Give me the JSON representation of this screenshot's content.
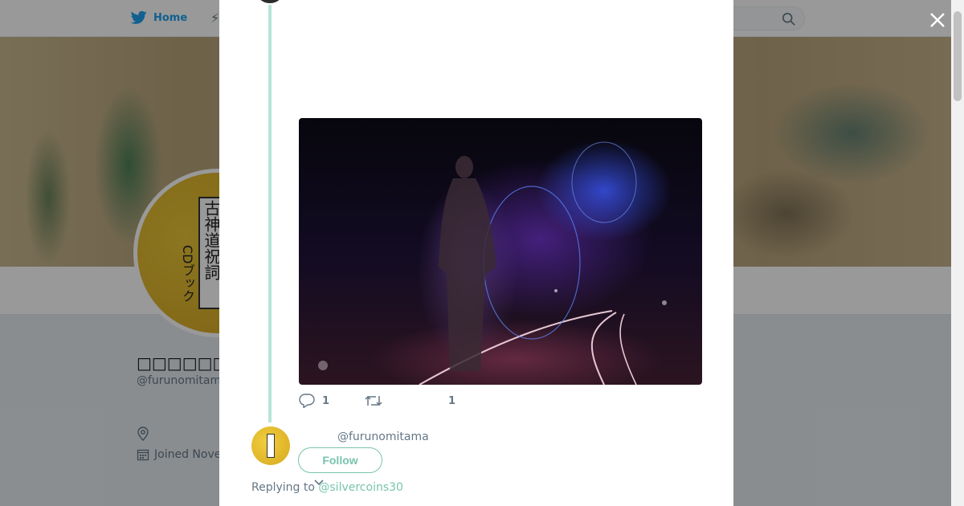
{
  "topbar": {
    "home_label": "Home",
    "home_icon": "twitter-bird-icon",
    "moments_icon": "lightning-icon",
    "search_icon": "search-icon"
  },
  "profile": {
    "name": "□□□□□□□□□□□",
    "handle": "@furunomitam",
    "joined": "Joined Nove",
    "avatar_text": "古神道祝詞",
    "avatar_sub": "CDブック"
  },
  "modal": {
    "close_icon": "close-icon",
    "tweet_image_desc_colors": {
      "accent_blue": "#3d5cff",
      "accent_purple": "#6e32c8"
    },
    "actions": {
      "reply_count": "1",
      "retweet_count": "",
      "like_count": "1"
    },
    "reply": {
      "handle": "@furunomitama",
      "follow_label": "Follow",
      "replying_prefix": "Replying to ",
      "replying_to": "@silvercoins30"
    }
  },
  "colors": {
    "twitter_blue": "#1da1f2",
    "follow_green": "#78c4ad",
    "thread_line": "#b8e4d9",
    "muted_text": "#657786"
  }
}
